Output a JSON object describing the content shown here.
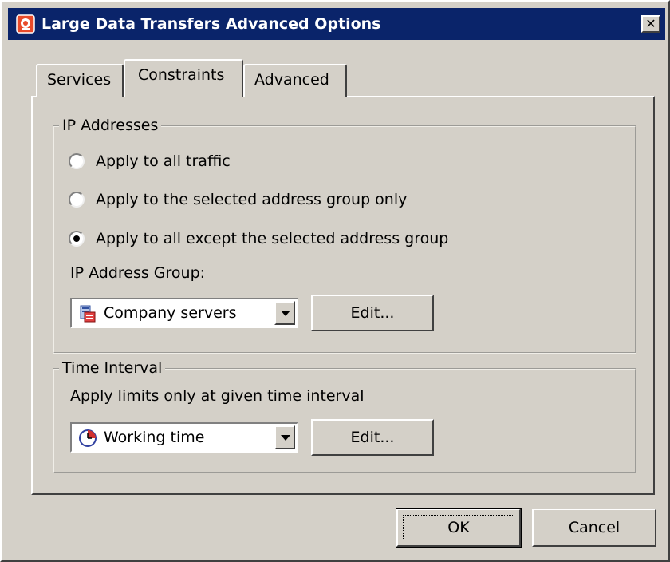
{
  "window": {
    "title": "Large Data Transfers Advanced Options",
    "close_label": "✕",
    "icon": "app-icon"
  },
  "tabs": [
    {
      "label": "Services",
      "active": false
    },
    {
      "label": "Constraints",
      "active": true
    },
    {
      "label": "Advanced",
      "active": false
    }
  ],
  "ip_addresses": {
    "legend": "IP Addresses",
    "options": [
      {
        "label": "Apply to all traffic",
        "selected": false
      },
      {
        "label": "Apply to the selected address group only",
        "selected": false
      },
      {
        "label": "Apply to all except the selected address group",
        "selected": true
      }
    ],
    "group_label": "IP Address Group:",
    "group_select": {
      "value": "Company servers",
      "icon": "address-group-icon"
    },
    "edit_label": "Edit..."
  },
  "time_interval": {
    "legend": "Time Interval",
    "description": "Apply limits only at given time interval",
    "select": {
      "value": "Working time",
      "icon": "clock-icon"
    },
    "edit_label": "Edit..."
  },
  "footer": {
    "ok_label": "OK",
    "cancel_label": "Cancel"
  },
  "colors": {
    "titlebar": "#0a246a",
    "dialog_bg": "#d4d0c8"
  }
}
